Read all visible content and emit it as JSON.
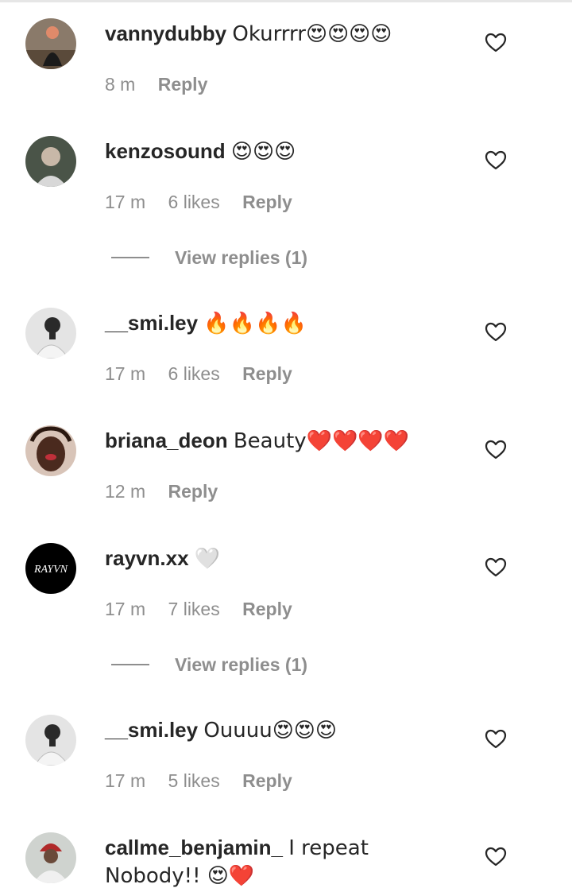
{
  "comments": [
    {
      "username": "vannydubby",
      "text": "Okurrrr😍😍😍😍",
      "time": "8 m",
      "likes": "",
      "reply_label": "Reply",
      "view_replies": ""
    },
    {
      "username": "kenzosound",
      "text": "😍😍😍",
      "time": "17 m",
      "likes": "6 likes",
      "reply_label": "Reply",
      "view_replies": "View replies (1)"
    },
    {
      "username": "__smi.ley",
      "text": "🔥🔥🔥🔥",
      "time": "17 m",
      "likes": "6 likes",
      "reply_label": "Reply",
      "view_replies": ""
    },
    {
      "username": "briana_deon",
      "text": "Beauty❤️❤️❤️❤️",
      "time": "12 m",
      "likes": "",
      "reply_label": "Reply",
      "view_replies": ""
    },
    {
      "username": "rayvn.xx",
      "text": "🤍",
      "time": "17 m",
      "likes": "7 likes",
      "reply_label": "Reply",
      "view_replies": "View replies (1)",
      "avatar_text": "RAYVN"
    },
    {
      "username": "__smi.ley",
      "text": "Ouuuu😍😍😍",
      "time": "17 m",
      "likes": "5 likes",
      "reply_label": "Reply",
      "view_replies": ""
    },
    {
      "username": "callme_benjamin_",
      "text": "I repeat Nobody!! 😍❤️",
      "time": "",
      "likes": "",
      "reply_label": "",
      "view_replies": ""
    }
  ],
  "icons": {
    "like": "heart-outline-icon"
  },
  "colors": {
    "username": "#262626",
    "meta": "#8e8e8e",
    "background": "#ffffff"
  }
}
